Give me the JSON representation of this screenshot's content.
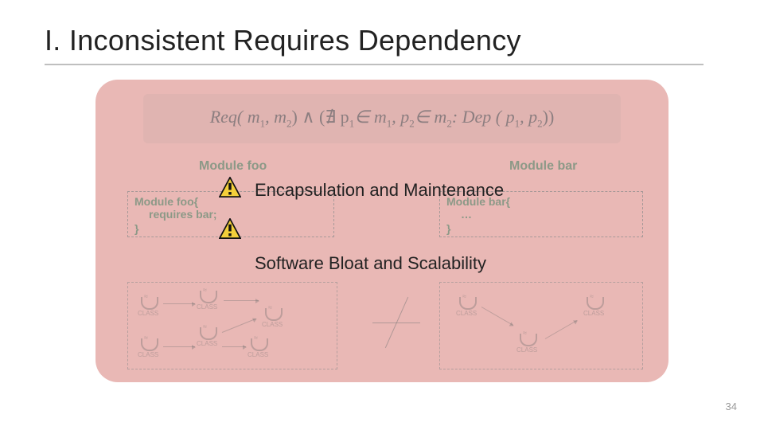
{
  "title": "I.  Inconsistent Requires Dependency",
  "formula": {
    "pre": "Req( m",
    "s1": "1",
    "mid1": ", m",
    "s2": "2",
    "mid2": ") ∧ (∄ p",
    "s3": "1",
    "mid3": "∈ m",
    "s4": "1",
    "mid4": ", p",
    "s5": "2",
    "mid5": "∈ m",
    "s6": "2",
    "mid6": ": Dep ( p",
    "s7": "1",
    "mid7": ", p",
    "s8": "2",
    "post": "))"
  },
  "modules": {
    "left_header": "Module foo",
    "right_header": "Module bar",
    "foo_l1": "Module foo{",
    "foo_l2": "requires bar;",
    "bar_l1": "Module bar{",
    "bar_l2": "…",
    "close": "}"
  },
  "captions": {
    "c1": "Encapsulation and Maintenance",
    "c2": "Software Bloat and Scalability"
  },
  "diagram": {
    "node_label": "CLASS"
  },
  "page_number": "34"
}
